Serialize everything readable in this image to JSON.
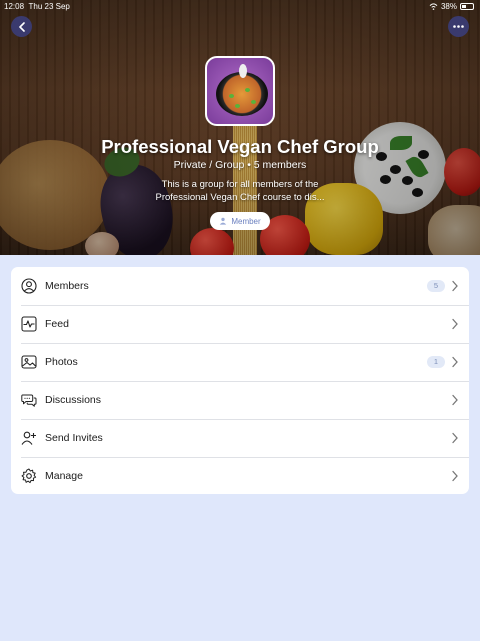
{
  "status_bar": {
    "time": "12:08",
    "date": "Thu 23 Sep",
    "battery": "38%"
  },
  "header": {
    "back_icon": "chevron-left-icon",
    "more_icon": "ellipsis-icon",
    "group_title": "Professional Vegan Chef Group",
    "group_meta": "Private / Group • 5 members",
    "description_line1": "This is a group for all members of the",
    "description_line2": "Professional Vegan Chef course to dis...",
    "member_button_label": "Member"
  },
  "menu": {
    "items": [
      {
        "label": "Members",
        "icon": "person-icon",
        "badge": "5"
      },
      {
        "label": "Feed",
        "icon": "activity-icon",
        "badge": ""
      },
      {
        "label": "Photos",
        "icon": "photo-icon",
        "badge": "1"
      },
      {
        "label": "Discussions",
        "icon": "chat-bubbles-icon",
        "badge": ""
      },
      {
        "label": "Send Invites",
        "icon": "person-add-icon",
        "badge": ""
      },
      {
        "label": "Manage",
        "icon": "gear-icon",
        "badge": ""
      }
    ]
  },
  "colors": {
    "page_background": "#dfe7fb",
    "round_button": "#3a3a6e",
    "badge_background": "#e2e9f7",
    "badge_text": "#7d8fb8",
    "member_pill_text": "#6a7fbf"
  }
}
